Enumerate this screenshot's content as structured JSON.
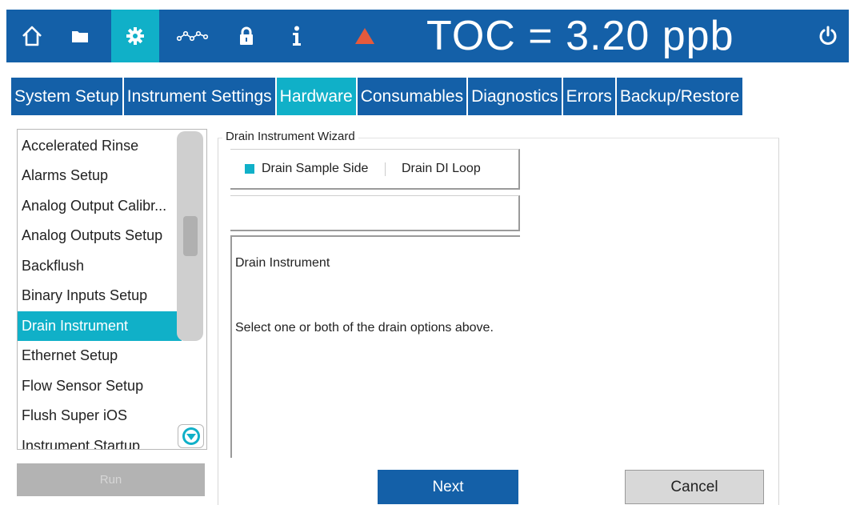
{
  "colors": {
    "primary": "#1460a8",
    "accent": "#10b0c8",
    "warning": "#e55a3c",
    "disabled": "#b3b3b3"
  },
  "topbar": {
    "icons": [
      "home-icon",
      "folder-icon",
      "gear-icon",
      "trend-icon",
      "lock-icon",
      "info-icon",
      "warning-icon",
      "power-icon"
    ],
    "active_icon": "gear-icon",
    "readout": "TOC = 3.20 ppb"
  },
  "tabs": [
    {
      "label": "System Setup",
      "active": false
    },
    {
      "label": "Instrument Settings",
      "active": false
    },
    {
      "label": "Hardware",
      "active": true
    },
    {
      "label": "Consumables",
      "active": false
    },
    {
      "label": "Diagnostics",
      "active": false
    },
    {
      "label": "Errors",
      "active": false
    },
    {
      "label": "Backup/Restore",
      "active": false
    }
  ],
  "sidebar": {
    "items": [
      {
        "label": "Accelerated Rinse",
        "active": false
      },
      {
        "label": "Alarms Setup",
        "active": false
      },
      {
        "label": "Analog Output Calibr...",
        "active": false
      },
      {
        "label": "Analog Outputs Setup",
        "active": false
      },
      {
        "label": "Backflush",
        "active": false
      },
      {
        "label": "Binary Inputs Setup",
        "active": false
      },
      {
        "label": "Drain Instrument",
        "active": true
      },
      {
        "label": "Ethernet Setup",
        "active": false
      },
      {
        "label": "Flow Sensor Setup",
        "active": false
      },
      {
        "label": "Flush Super iOS",
        "active": false
      },
      {
        "label": "Instrument Startup",
        "active": false
      }
    ],
    "run_label": "Run"
  },
  "wizard": {
    "title": "Drain Instrument Wizard",
    "options": [
      {
        "label": "Drain Sample Side",
        "selected": true
      },
      {
        "label": "Drain DI Loop",
        "selected": false
      }
    ],
    "info_heading": "Drain Instrument",
    "info_text": "Select one or both of the drain options above.",
    "next_label": "Next",
    "cancel_label": "Cancel"
  }
}
